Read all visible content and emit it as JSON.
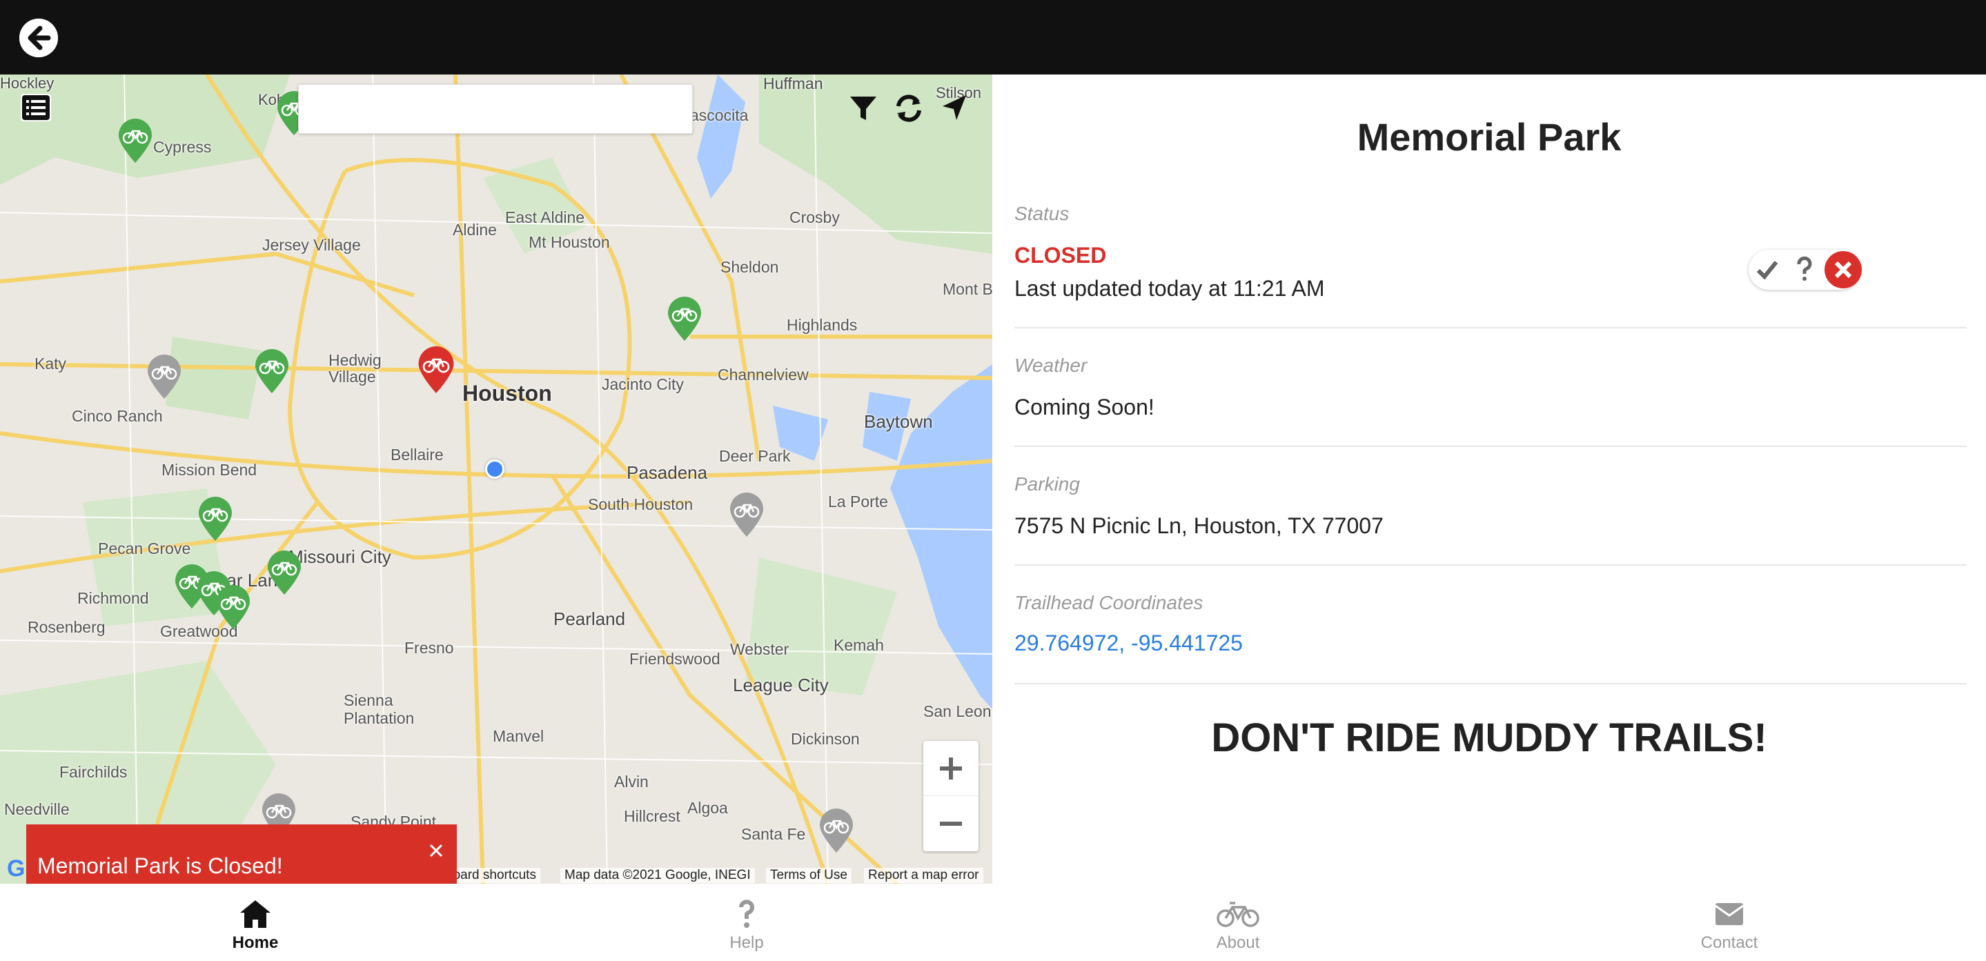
{
  "header": {
    "back_icon": "arrow-left-circle-icon"
  },
  "map": {
    "search": {
      "value": "",
      "placeholder": ""
    },
    "tools": [
      "list-icon",
      "filter-icon",
      "refresh-icon",
      "location-arrow-icon"
    ],
    "labels": {
      "hockley": "Hockley",
      "kohrville": "Koh",
      "huffman": "Huffman",
      "stilson": "Stilson",
      "cypress": "Cypress",
      "ascocita": "ascocita",
      "aldine": "Aldine",
      "east_aldine": "East Aldine",
      "mt_houston": "Mt Houston",
      "crosby": "Crosby",
      "jersey_village": "Jersey Village",
      "sheldon": "Sheldon",
      "mont_belvieu": "Mont B",
      "highlands": "Highlands",
      "katy": "Katy",
      "hedwig_village": "Hedwig\nVillage",
      "houston": "Houston",
      "jacinto_city": "Jacinto City",
      "channelview": "Channelview",
      "cinco_ranch": "Cinco Ranch",
      "baytown": "Baytown",
      "bellaire": "Bellaire",
      "deer_park": "Deer Park",
      "mission_bend": "Mission Bend",
      "pasadena": "Pasadena",
      "south_houston": "South Houston",
      "la_porte": "La Porte",
      "pecan_grove": "Pecan Grove",
      "missouri_city": "Missouri City",
      "richmond": "Richmond",
      "sugar_land": "gar Land",
      "rosenberg": "Rosenberg",
      "greatwood": "Greatwood",
      "pearland": "Pearland",
      "fresno": "Fresno",
      "friendswood": "Friendswood",
      "webster": "Webster",
      "kemah": "Kemah",
      "league_city": "League City",
      "sienna_plantation": "Sienna\nPlantation",
      "san_leon": "San Leon",
      "manvel": "Manvel",
      "dickinson": "Dickinson",
      "fairchilds": "Fairchilds",
      "alvin": "Alvin",
      "needville": "Needville",
      "algoa": "Algoa",
      "hillcrest": "Hillcrest",
      "santa_fe": "Santa Fe",
      "sandy_point": "Sandy Point"
    },
    "footer": {
      "shortcuts": "board shortcuts",
      "map_data": "Map data ©2021 Google, INEGI",
      "terms": "Terms of Use",
      "report": "Report a map error",
      "logo": "G"
    },
    "zoom_in_icon": "plus-icon",
    "zoom_out_icon": "minus-icon",
    "pin_colors": {
      "open": "#4caa4f",
      "closed": "#d9302c",
      "unknown": "#9e9e9e"
    }
  },
  "toast": {
    "message": "Memorial Park is Closed!",
    "close_icon": "close-icon"
  },
  "panel": {
    "title": "Memorial Park",
    "status": {
      "label": "Status",
      "value": "CLOSED",
      "updated": "Last updated today at 11:21 AM",
      "options": [
        "check-icon",
        "question-icon",
        "x-circle-icon"
      ]
    },
    "weather": {
      "label": "Weather",
      "value": "Coming Soon!"
    },
    "parking": {
      "label": "Parking",
      "value": "7575 N Picnic Ln, Houston, TX 77007"
    },
    "coordinates": {
      "label": "Trailhead Coordinates",
      "value": "29.764972, -95.441725"
    },
    "warning": "DON'T RIDE MUDDY TRAILS!"
  },
  "nav": {
    "items": [
      {
        "label": "Home",
        "icon": "home-icon"
      },
      {
        "label": "Help",
        "icon": "question-icon"
      },
      {
        "label": "About",
        "icon": "bicycle-icon"
      },
      {
        "label": "Contact",
        "icon": "envelope-icon"
      }
    ]
  },
  "colors": {
    "header": "#111111",
    "closed_red": "#d9302c",
    "link_blue": "#2b7de0",
    "map_bg": "#ebe8e1"
  }
}
